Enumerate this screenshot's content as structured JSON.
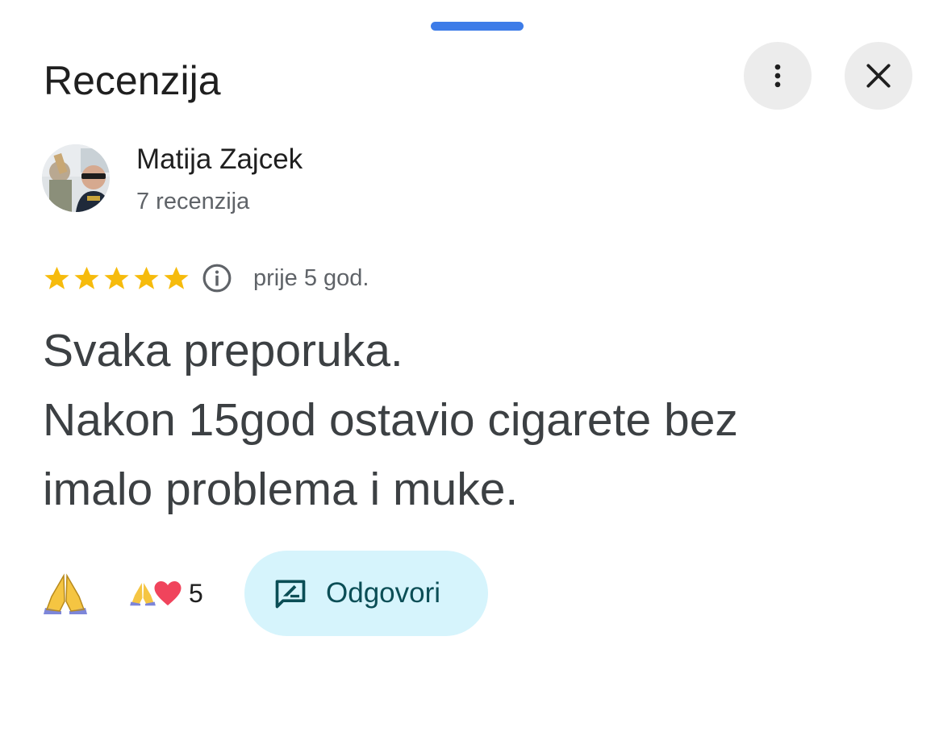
{
  "header": {
    "title": "Recenzija",
    "more_icon": "more-vert-icon",
    "close_icon": "close-icon"
  },
  "author": {
    "name": "Matija Zajcek",
    "review_count": "7 recenzija",
    "avatar": "profile-photo"
  },
  "rating": {
    "stars": 5,
    "max_stars": 5,
    "star_color": "#f6bb0c",
    "info_icon": "info-icon",
    "time_ago": "prije 5 god."
  },
  "review": {
    "lines": [
      "Svaka preporuka.",
      "Nakon 15god ostavio cigarete bez",
      "imalo problema i muke."
    ]
  },
  "reactions": {
    "add_reaction_icon": "folded-hands-icon",
    "summary_icons": [
      "folded-hands-icon",
      "heart-icon"
    ],
    "count": "5"
  },
  "reply_button": {
    "label": "Odgovori",
    "icon": "reply-review-icon",
    "background": "#d6f4fc",
    "text_color": "#0b4e56"
  },
  "accent": "#3d7ce8"
}
